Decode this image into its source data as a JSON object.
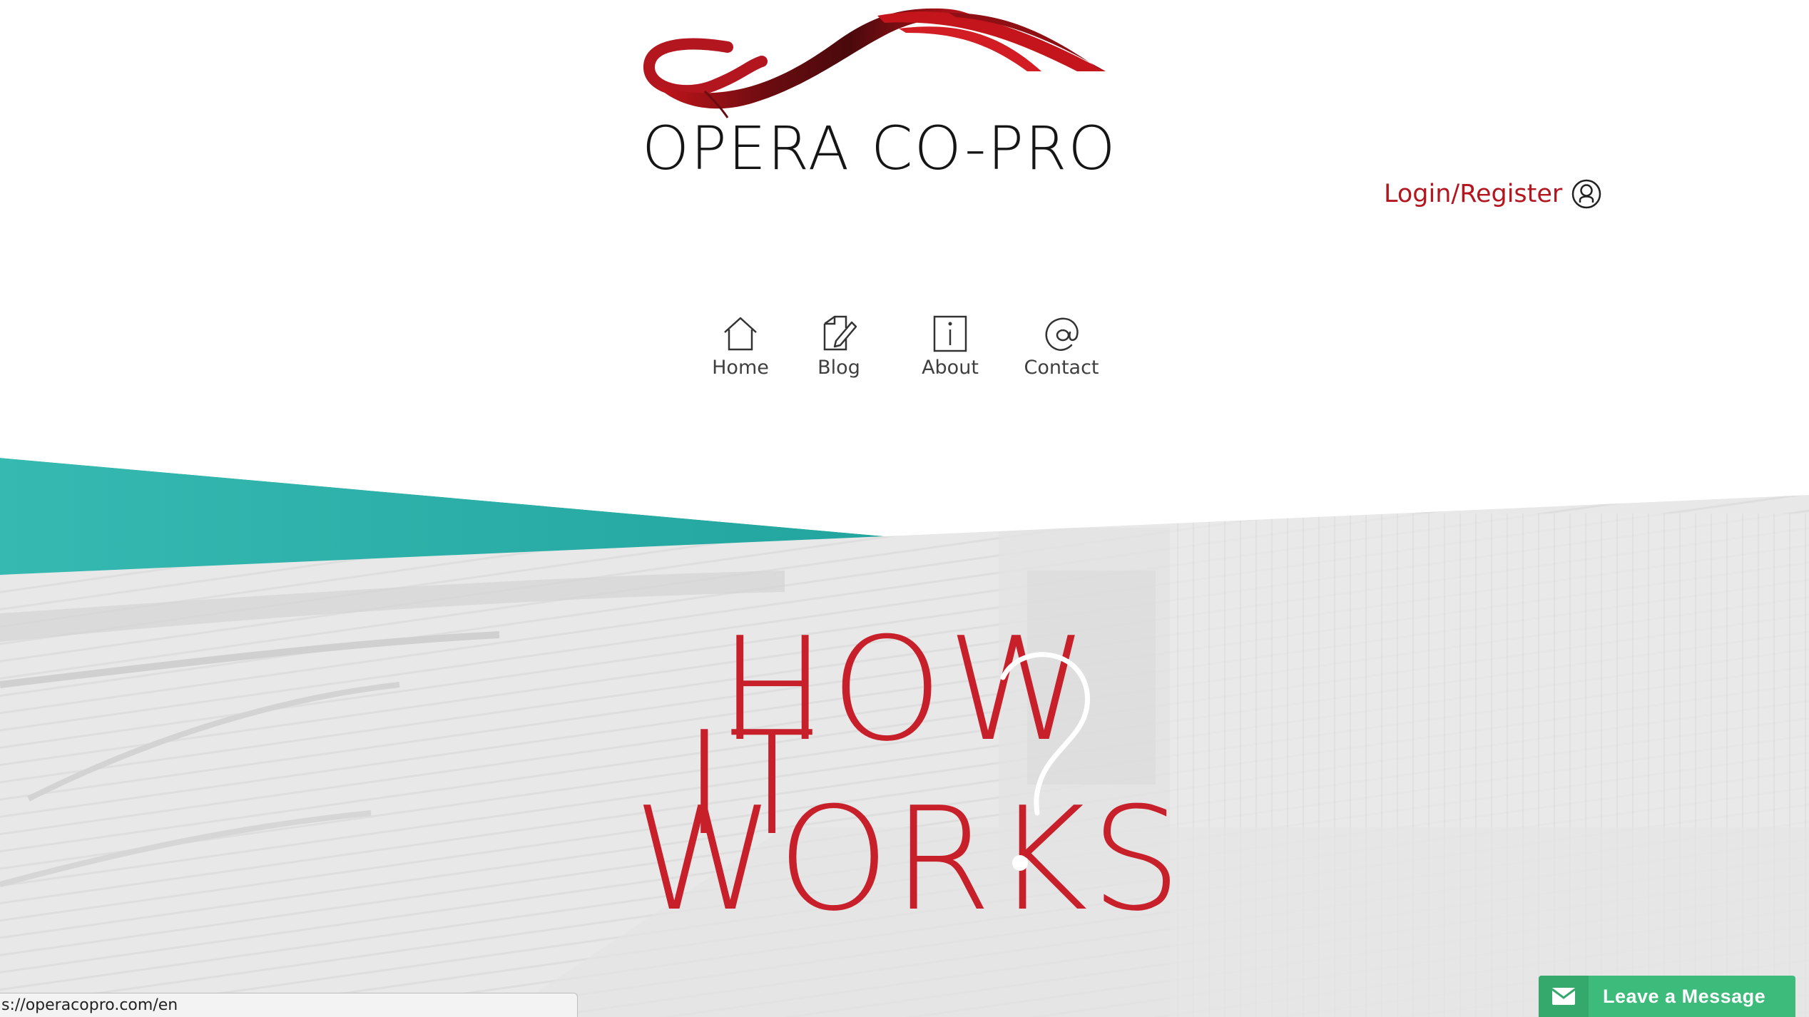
{
  "brand": {
    "name": "OPERA CO-PRO",
    "colors": {
      "accent_red": "#b3161f",
      "dark_red": "#5a0b0e",
      "teal": "#2aaba5",
      "widget_green": "#3dbb7a"
    }
  },
  "header": {
    "login_label": "Login/Register",
    "login_icon": "user-circle-icon"
  },
  "nav": {
    "items": [
      {
        "label": "Home",
        "icon": "house-icon"
      },
      {
        "label": "Blog",
        "icon": "edit-note-icon"
      },
      {
        "label": "About",
        "icon": "info-icon"
      },
      {
        "label": "Contact",
        "icon": "at-sign-icon"
      }
    ]
  },
  "hero": {
    "line1": "HOW",
    "line2": "IT",
    "line3": "WORKS"
  },
  "status_bar": {
    "url": "s://operacopro.com/en"
  },
  "message_widget": {
    "label": "Leave a Message",
    "icon": "envelope-icon"
  }
}
